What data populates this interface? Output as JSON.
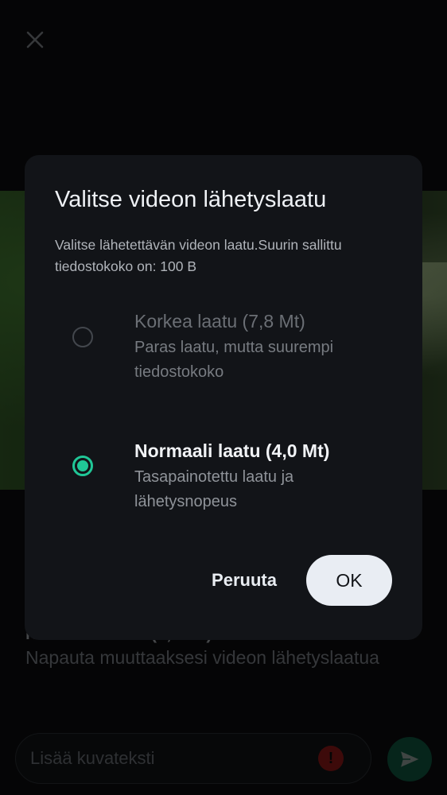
{
  "background": {
    "close_icon": "close-icon",
    "caption": {
      "current_quality": "Normaali laatu (4,0 Mt)",
      "hint": "Napauta muuttaaksesi videon lähetyslaatua"
    },
    "caption_input": {
      "placeholder": "Lisää kuvateksti",
      "info_icon": "info-icon"
    },
    "send_icon": "send-icon"
  },
  "dialog": {
    "title": "Valitse videon lähetyslaatu",
    "description": "Valitse lähetettävän videon laatu.Suurin sallittu tiedostokoko on: 100 B",
    "options": [
      {
        "title": "Korkea laatu (7,8 Mt)",
        "subtitle": "Paras laatu, mutta suurempi tiedostokoko",
        "selected": false,
        "enabled": false
      },
      {
        "title": "Normaali laatu (4,0 Mt)",
        "subtitle": "Tasapainotettu laatu ja lähetysnopeus",
        "selected": true,
        "enabled": true
      }
    ],
    "cancel_label": "Peruuta",
    "ok_label": "OK"
  },
  "colors": {
    "accent": "#20c797",
    "send_button": "#0c4a37",
    "info_icon": "#7a1514"
  }
}
